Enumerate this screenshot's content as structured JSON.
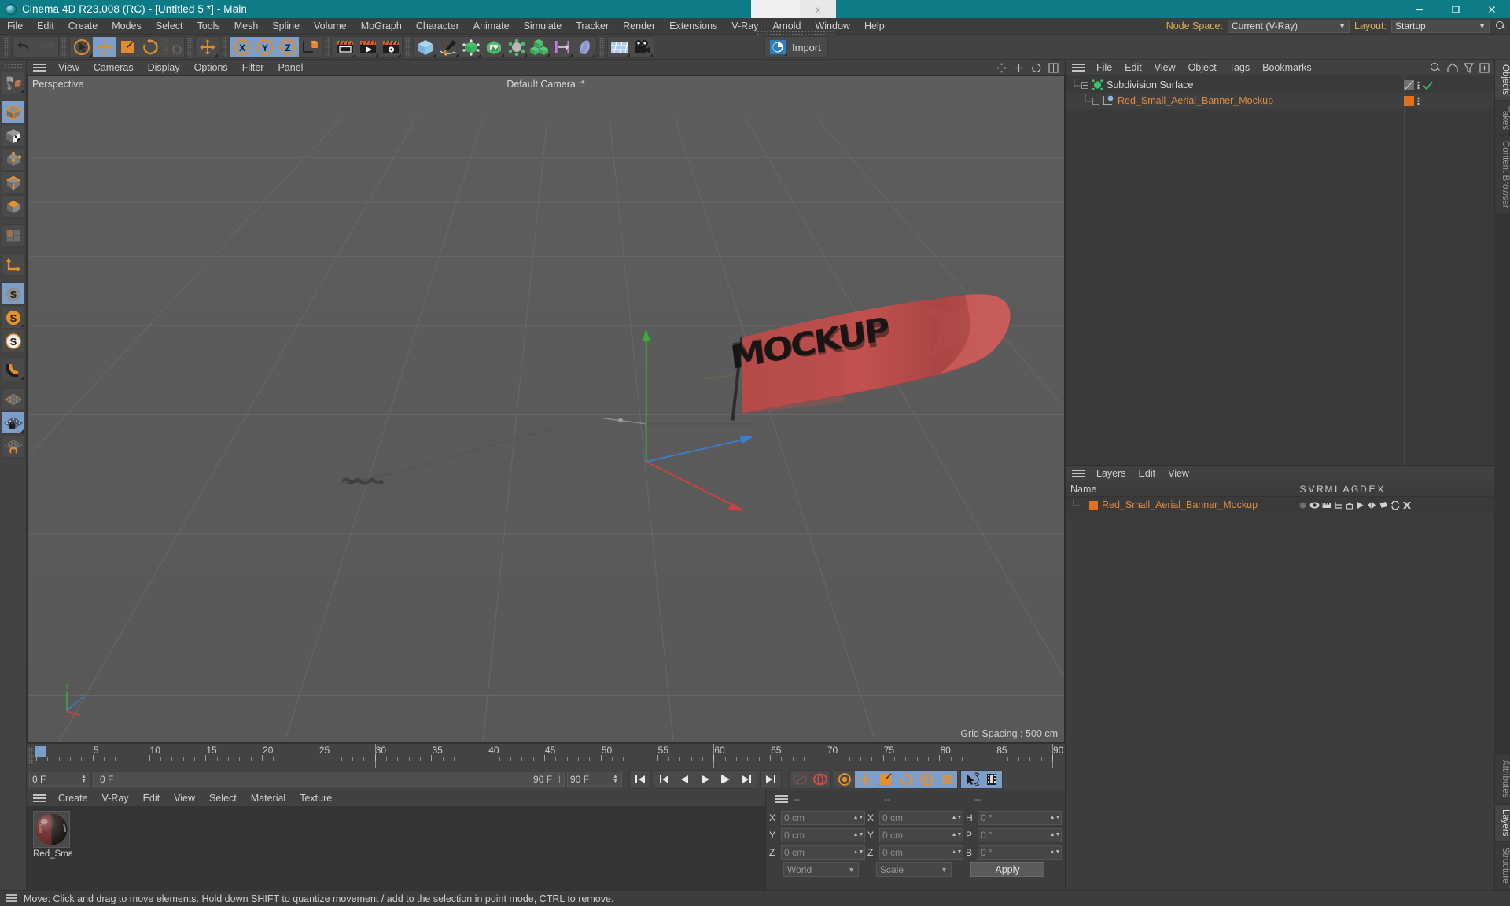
{
  "window": {
    "title": "Cinema 4D R23.008 (RC) - [Untitled 5 *] - Main",
    "logo_icon": "cinema4d-logo-icon",
    "minimize_label": "─",
    "maximize_label": "☐",
    "close_label": "✕"
  },
  "menubar": {
    "items": [
      {
        "label": "File"
      },
      {
        "label": "Edit"
      },
      {
        "label": "Create"
      },
      {
        "label": "Modes"
      },
      {
        "label": "Select"
      },
      {
        "label": "Tools"
      },
      {
        "label": "Mesh"
      },
      {
        "label": "Spline"
      },
      {
        "label": "Volume"
      },
      {
        "label": "MoGraph"
      },
      {
        "label": "Character"
      },
      {
        "label": "Animate"
      },
      {
        "label": "Simulate"
      },
      {
        "label": "Tracker"
      },
      {
        "label": "Render"
      },
      {
        "label": "Extensions"
      },
      {
        "label": "V-Ray"
      },
      {
        "label": "Arnold"
      },
      {
        "label": "Window"
      },
      {
        "label": "Help"
      }
    ],
    "node_space_label": "Node Space:",
    "node_space_value": "Current (V-Ray)",
    "layout_label": "Layout:",
    "layout_value": "Startup",
    "search_icon": "search-icon",
    "overlay_close_label": "x"
  },
  "toolbar": {
    "undo": "undo-arrow-icon",
    "redo": "redo-arrow-icon",
    "live_selection": "live-selection-icon",
    "move": "move-tool-icon",
    "scale": "scale-tool-icon",
    "rotate": "rotate-tool-icon",
    "psr": "psr-icon",
    "move_dup": "move-duplicate-icon",
    "x_axis": "x-axis-lock-icon",
    "y_axis": "y-axis-lock-icon",
    "z_axis": "z-axis-lock-icon",
    "world_object": "world-object-axis-icon",
    "render_view": "render-view-icon",
    "render_picture": "render-to-picture-viewer-icon",
    "render_settings": "render-settings-icon",
    "cube": "add-cube-icon",
    "pen": "spline-pen-icon",
    "nurbs": "generator-nurbs-icon",
    "deformer": "deformer-icon",
    "environment": "environment-icon",
    "mograph": "mograph-cloner-icon",
    "scene": "scene-nodes-icon",
    "dynamics": "dynamics-icon",
    "tools": "tools-icon",
    "camera": "camera-icon",
    "import_label": "Import",
    "import_icon": "cinema4d-import-icon"
  },
  "left_toolbar": {
    "items": [
      {
        "name": "make-editable-icon",
        "selected": false
      },
      {
        "name": "model-mode-icon",
        "selected": true
      },
      {
        "name": "texture-mode-icon",
        "selected": false
      },
      {
        "name": "point-mode-icon",
        "selected": false
      },
      {
        "name": "edge-mode-icon",
        "selected": false
      },
      {
        "name": "polygon-mode-icon",
        "selected": false
      },
      {
        "name": "uv-mode-icon",
        "selected": false
      },
      {
        "name": "axis-mode-icon",
        "selected": false
      },
      {
        "name": "enable-axis-icon",
        "selected": true
      },
      {
        "name": "object-axis-icon",
        "selected": false
      },
      {
        "name": "world-axis-icon",
        "selected": false
      },
      {
        "name": "magnet-tool-icon",
        "selected": false
      },
      {
        "name": "workplane-icon",
        "selected": false
      },
      {
        "name": "lock-workplane-icon",
        "selected": true
      },
      {
        "name": "planar-workplane-icon",
        "selected": false
      }
    ]
  },
  "viewport": {
    "menu": [
      {
        "label": "View"
      },
      {
        "label": "Cameras"
      },
      {
        "label": "Display"
      },
      {
        "label": "Options"
      },
      {
        "label": "Filter"
      },
      {
        "label": "Panel"
      }
    ],
    "projection_label": "Perspective",
    "camera_label": "Default Camera :*",
    "grid_spacing": "Grid Spacing : 500 cm",
    "axis_x_label": "X",
    "axis_y_label": "Y",
    "axis_z_label": "Z",
    "banner_text": "MOCKUP",
    "banner_color": "#bf4a4a",
    "background_color": "#5a5a5a"
  },
  "timeline": {
    "ticks": [
      0,
      5,
      10,
      15,
      20,
      25,
      30,
      35,
      40,
      45,
      50,
      55,
      60,
      65,
      70,
      75,
      80,
      85,
      90
    ],
    "start": 0,
    "end": 90,
    "current_frame_label": "0 F",
    "playhead_label": "0 F",
    "range_start_field": "0 F",
    "range_end_label": "90 F",
    "range_end_field": "90 F",
    "preview_end_field": "0 F"
  },
  "transport": {
    "buttons": [
      {
        "name": "go-to-start-button",
        "glyph": "⏮"
      },
      {
        "name": "previous-key-button",
        "glyph": "⏴"
      },
      {
        "name": "step-back-button",
        "glyph": "◀"
      },
      {
        "name": "play-button",
        "glyph": "▶"
      },
      {
        "name": "step-forward-button",
        "glyph": "▶"
      },
      {
        "name": "next-key-button",
        "glyph": "⏵"
      },
      {
        "name": "go-to-end-button",
        "glyph": "⏭"
      }
    ],
    "record_icons": [
      {
        "name": "autokey-icon"
      },
      {
        "name": "record-active-objects-icon"
      },
      {
        "name": "keyframe-selection-icon"
      },
      {
        "name": "position-key-icon"
      },
      {
        "name": "scale-key-icon"
      },
      {
        "name": "rotation-key-icon"
      },
      {
        "name": "param-key-icon"
      },
      {
        "name": "point-level-animation-icon"
      },
      {
        "name": "animation-mode-icon"
      },
      {
        "name": "timeline-icon"
      }
    ]
  },
  "material_manager": {
    "menu": [
      {
        "label": "Create"
      },
      {
        "label": "V-Ray"
      },
      {
        "label": "Edit"
      },
      {
        "label": "View"
      },
      {
        "label": "Select"
      },
      {
        "label": "Material"
      },
      {
        "label": "Texture"
      }
    ],
    "materials": [
      {
        "name": "Red_Sma",
        "full_name": "Red_Small_Aerial_Banner_Mockup",
        "color": "#b43a3a"
      }
    ]
  },
  "coordinates": {
    "header_cols": [
      "--",
      "--",
      "--"
    ],
    "rows": [
      {
        "pos_label": "X",
        "pos_value": "0 cm",
        "size_label": "X",
        "size_value": "0 cm",
        "rot_label": "H",
        "rot_value": "0 °"
      },
      {
        "pos_label": "Y",
        "pos_value": "0 cm",
        "size_label": "Y",
        "size_value": "0 cm",
        "rot_label": "P",
        "rot_value": "0 °"
      },
      {
        "pos_label": "Z",
        "pos_value": "0 cm",
        "size_label": "Z",
        "size_value": "0 cm",
        "rot_label": "B",
        "rot_value": "0 °"
      }
    ],
    "space_value": "World",
    "mode_value": "Scale",
    "apply_label": "Apply"
  },
  "object_manager": {
    "menu": [
      {
        "label": "File"
      },
      {
        "label": "Edit"
      },
      {
        "label": "View"
      },
      {
        "label": "Object"
      },
      {
        "label": "Tags"
      },
      {
        "label": "Bookmarks"
      }
    ],
    "icons": [
      {
        "name": "search-icon"
      },
      {
        "name": "home-icon"
      },
      {
        "name": "filter-icon"
      },
      {
        "name": "add-panel-icon"
      }
    ],
    "rows": [
      {
        "label": "Subdivision Surface",
        "icon": "subdivision-surface-icon",
        "selected": false,
        "depth": 0,
        "tags": [
          "phong-tag-icon",
          "dots-icon",
          "check-icon"
        ]
      },
      {
        "label": "Red_Small_Aerial_Banner_Mockup",
        "icon": "polygon-object-icon",
        "selected": true,
        "depth": 1,
        "tags": [
          "material-tag-icon",
          "dots-icon"
        ]
      }
    ]
  },
  "layer_manager": {
    "menu": [
      {
        "label": "Layers"
      },
      {
        "label": "Edit"
      },
      {
        "label": "View"
      }
    ],
    "name_header": "Name",
    "columns": [
      "S",
      "V",
      "R",
      "M",
      "L",
      "A",
      "G",
      "D",
      "E",
      "X"
    ],
    "rows": [
      {
        "label": "Red_Small_Aerial_Banner_Mockup",
        "color": "#e0721e"
      }
    ]
  },
  "right_tabs_top": [
    {
      "label": "Objects",
      "active": true
    },
    {
      "label": "Takes",
      "active": false
    },
    {
      "label": "Content Browser",
      "active": false
    }
  ],
  "right_tabs_bottom": [
    {
      "label": "Attributes",
      "active": false
    },
    {
      "label": "Layers",
      "active": true
    },
    {
      "label": "Structure",
      "active": false
    }
  ],
  "statusbar": {
    "text": "Move: Click and drag to move elements. Hold down SHIFT to quantize movement / add to the selection in point mode, CTRL to remove."
  },
  "colors": {
    "titlebar": "#0e7c86",
    "panel": "#3d3d3d",
    "selection_blue": "#7d9ec9",
    "orange": "#e0721e",
    "accent_text": "#d5b25a"
  }
}
